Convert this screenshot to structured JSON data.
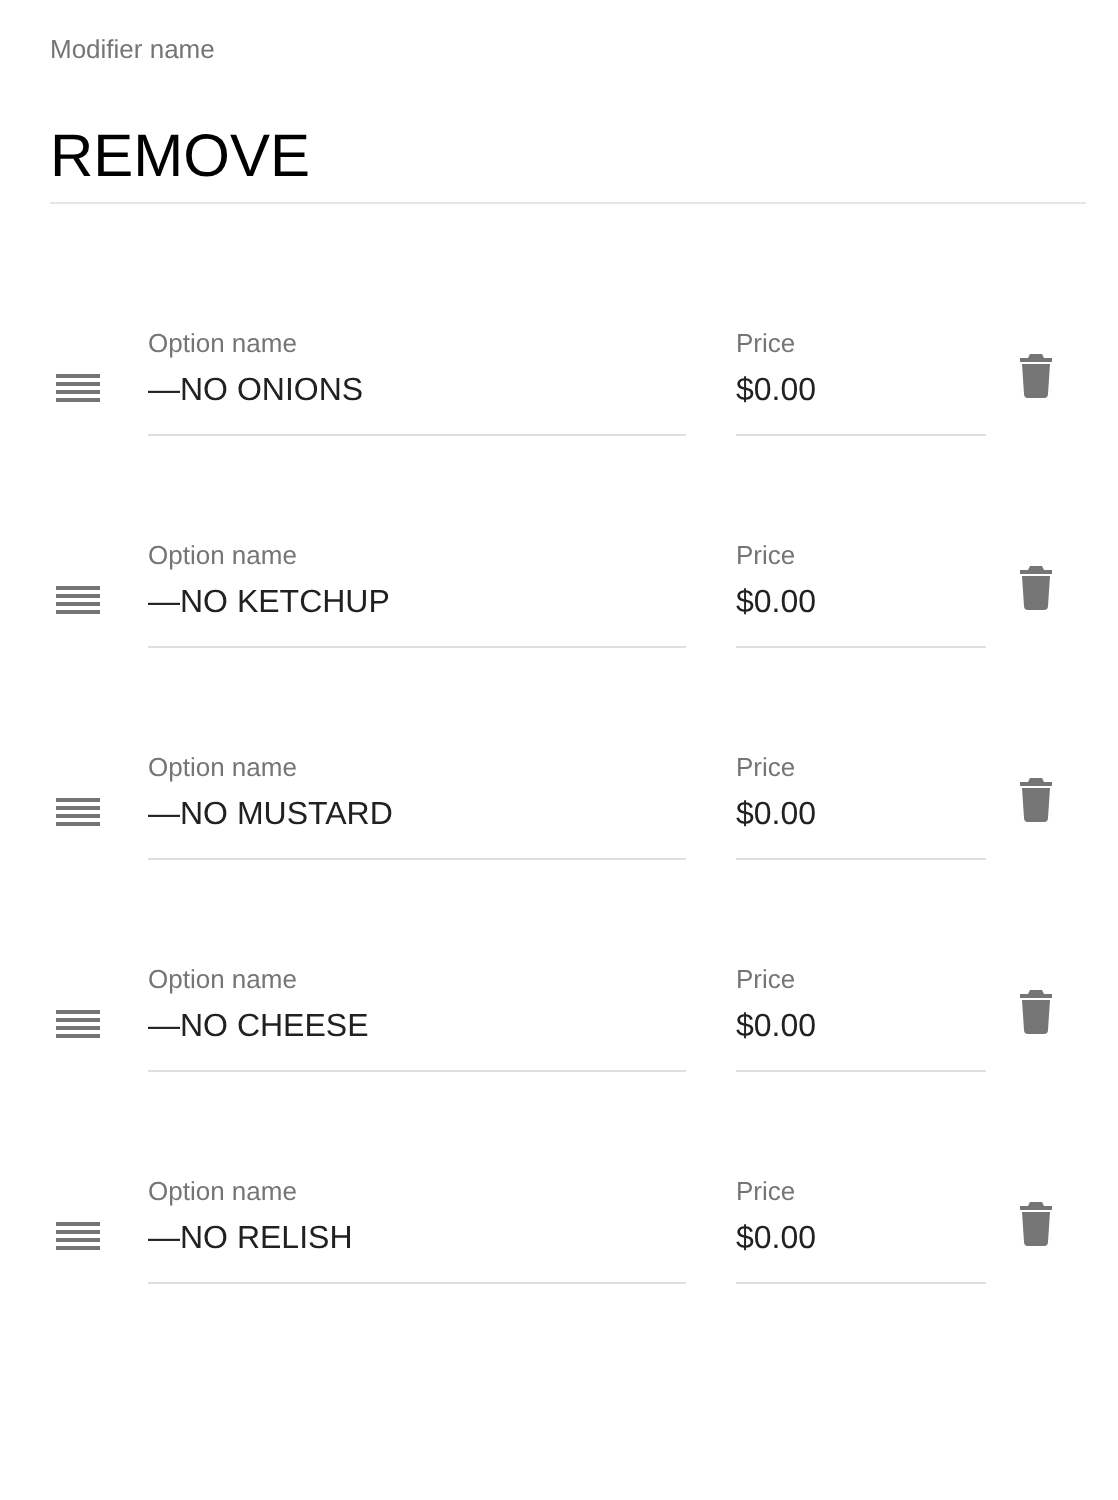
{
  "modifier": {
    "label": "Modifier name",
    "value": "REMOVE"
  },
  "options": [
    {
      "name_label": "Option name",
      "name": "—NO ONIONS",
      "price_label": "Price",
      "price": "$0.00"
    },
    {
      "name_label": "Option name",
      "name": "—NO KETCHUP",
      "price_label": "Price",
      "price": "$0.00"
    },
    {
      "name_label": "Option name",
      "name": "—NO MUSTARD",
      "price_label": "Price",
      "price": "$0.00"
    },
    {
      "name_label": "Option name",
      "name": "—NO CHEESE",
      "price_label": "Price",
      "price": "$0.00"
    },
    {
      "name_label": "Option name",
      "name": "—NO RELISH",
      "price_label": "Price",
      "price": "$0.00"
    }
  ]
}
